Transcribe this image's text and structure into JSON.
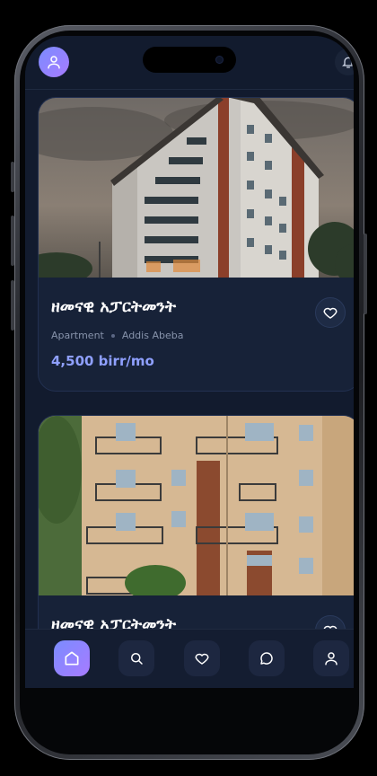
{
  "header": {
    "avatar_icon": "user-icon",
    "right_icon": "notification-icon"
  },
  "listings": [
    {
      "title": "ዘመናዊ አፓርትመንት",
      "type": "Apartment",
      "location": "Addis Abeba",
      "price": "4,500 birr/mo"
    },
    {
      "title": "ዘመናዊ አፓርትመንት"
    }
  ],
  "nav": [
    {
      "icon": "home-icon",
      "active": true
    },
    {
      "icon": "search-icon",
      "active": false
    },
    {
      "icon": "heart-icon",
      "active": false
    },
    {
      "icon": "chat-icon",
      "active": false
    },
    {
      "icon": "user-icon",
      "active": false
    }
  ],
  "colors": {
    "background": "#121b2e",
    "card": "#172238",
    "accent": "#8fa0ff",
    "accent_gradient_start": "#7b8cff",
    "accent_gradient_end": "#a77bff"
  }
}
